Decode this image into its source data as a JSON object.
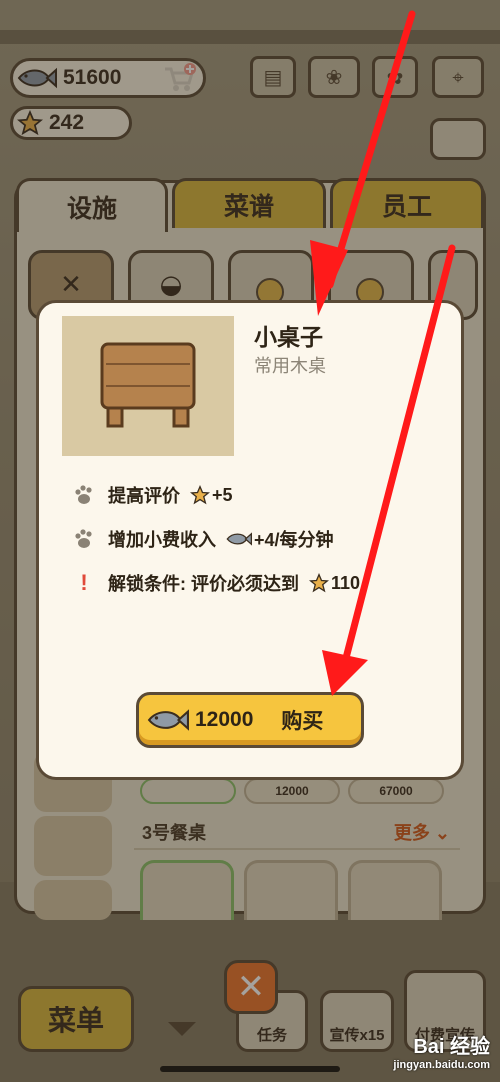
{
  "hud": {
    "coins": "51600",
    "stars": "242"
  },
  "tabs": [
    {
      "label": "设施",
      "active": true
    },
    {
      "label": "菜谱",
      "active": false
    },
    {
      "label": "员工",
      "active": false
    }
  ],
  "list": {
    "prices": [
      "12000",
      "67000"
    ],
    "section_title": "3号餐桌",
    "more_label": "更多"
  },
  "modal": {
    "title": "小桌子",
    "subtitle": "常用木桌",
    "attributes": [
      {
        "icon": "paw-icon",
        "text": "提高评价",
        "bonus_icon": "star-icon",
        "value": "+5"
      },
      {
        "icon": "paw-icon",
        "text": "增加小费收入",
        "bonus_icon": "fish-icon",
        "value": "+4/每分钟"
      },
      {
        "icon": "exclamation-icon",
        "text": "解锁条件: 评价必须达到",
        "bonus_icon": "star-icon",
        "value": "110"
      }
    ],
    "buy_price": "12000",
    "buy_label": "购买"
  },
  "bottom_bar": {
    "menu_label": "菜单",
    "task_label": "任务",
    "promo_label": "宣传x15",
    "promo2_label": "付费宣传"
  },
  "watermark": {
    "logo": "Bai 经验",
    "url": "jingyan.baidu.com"
  },
  "colors": {
    "accent_yellow": "#f6c53e",
    "outline": "#5a4a36",
    "annotation_red": "#ff1a1a",
    "close_orange": "#e8742e"
  }
}
